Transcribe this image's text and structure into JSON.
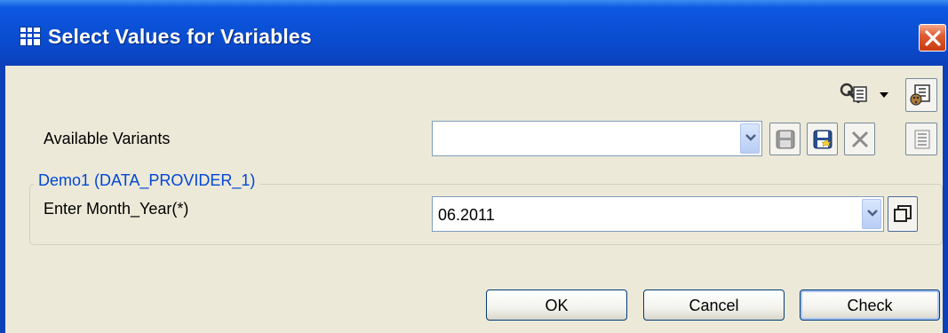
{
  "window": {
    "title": "Select Values for Variables"
  },
  "variants": {
    "label": "Available Variants",
    "value": ""
  },
  "group": {
    "title": "Demo1 (DATA_PROVIDER_1)",
    "field_label": "Enter Month_Year(*)",
    "field_value": "06.2011"
  },
  "buttons": {
    "ok": "OK",
    "cancel": "Cancel",
    "check": "Check"
  },
  "icons": [
    "grid-icon",
    "close-icon",
    "wrench-settings-icon",
    "dropdown-arrow-icon",
    "personalize-icon",
    "chevron-down-icon",
    "save-icon",
    "save-as-icon",
    "delete-icon",
    "details-icon",
    "value-help-icon"
  ]
}
